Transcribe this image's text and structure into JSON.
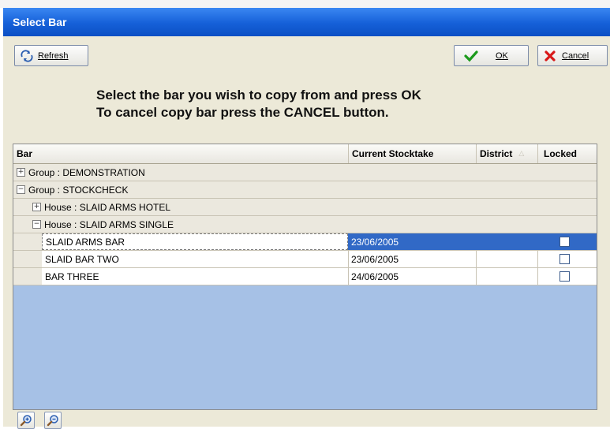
{
  "window": {
    "title": "Select Bar"
  },
  "toolbar": {
    "refresh_label": "Refresh",
    "ok_label": "OK",
    "cancel_label": "Cancel"
  },
  "message": {
    "line1": "Select the bar you wish to copy from and press OK",
    "line2": "To cancel copy bar press the CANCEL button."
  },
  "grid": {
    "columns": {
      "bar": "Bar",
      "stocktake": "Current Stocktake",
      "district": "District",
      "locked": "Locked"
    },
    "groups": [
      {
        "label": "Group : DEMONSTRATION",
        "expanded": false
      },
      {
        "label": "Group : STOCKCHECK",
        "expanded": true
      }
    ],
    "houses": [
      {
        "label": "House : SLAID ARMS HOTEL",
        "expanded": false
      },
      {
        "label": "House : SLAID ARMS SINGLE",
        "expanded": true
      }
    ],
    "rows": [
      {
        "bar": "SLAID ARMS BAR",
        "stocktake": "23/06/2005",
        "district": "",
        "locked": false,
        "selected": true
      },
      {
        "bar": "SLAID BAR TWO",
        "stocktake": "23/06/2005",
        "district": "",
        "locked": false,
        "selected": false
      },
      {
        "bar": "BAR THREE",
        "stocktake": "24/06/2005",
        "district": "",
        "locked": false,
        "selected": false
      }
    ]
  },
  "icons": {
    "refresh": "refresh-icon",
    "ok": "checkmark-icon",
    "cancel": "x-icon",
    "zoom_in": "zoom-in-icon",
    "zoom_out": "zoom-out-icon"
  },
  "colors": {
    "titlebar": "#1560d8",
    "selection": "#3169c6",
    "grid_empty": "#a6c1e6",
    "ok_check": "#1c9a1c",
    "cancel_x": "#d81818"
  }
}
